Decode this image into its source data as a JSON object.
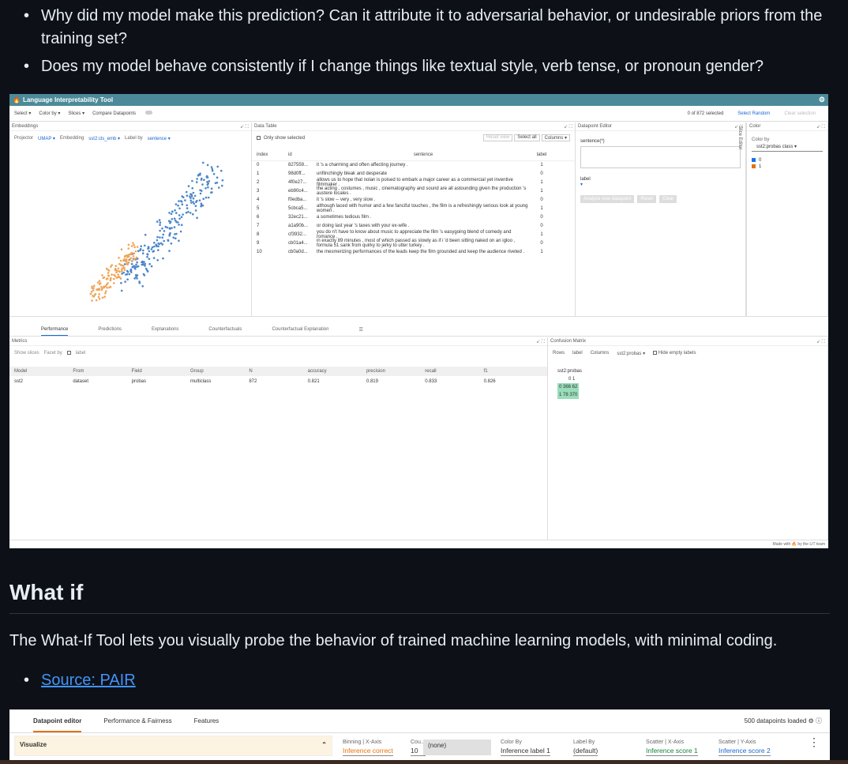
{
  "bullets": [
    "Why did my model make this prediction? Can it attribute it to adversarial behavior, or undesirable priors from the training set?",
    "Does my model behave consistently if I change things like textual style, verb tense, or pronoun gender?"
  ],
  "lit": {
    "title": "Language Interpretability Tool",
    "toolbar": {
      "select": "Select ▾",
      "color_by": "Color by ▾",
      "slices": "Slices ▾",
      "compare": "Compare Datapoints",
      "selected": "0 of 872 selected",
      "select_random": "Select Random",
      "clear": "Clear selection"
    },
    "embeddings": {
      "title": "Embeddings",
      "projector": "Projector",
      "projector_val": "UMAP ▾",
      "embedding": "Embedding",
      "embedding_val": "sst2:cls_emb ▾",
      "label_by": "Label by",
      "label_val": "sentence ▾"
    },
    "data_table": {
      "title": "Data Table",
      "only_selected": "Only show selected",
      "reset": "Reset view",
      "select_all": "Select all",
      "columns": "Columns ▾",
      "headers": [
        "index",
        "id",
        "sentence",
        "label"
      ],
      "rows": [
        [
          "0",
          "827559...",
          "it 's a charming and often affecting journey .",
          "1"
        ],
        [
          "1",
          "98d0ff...",
          "unflinchingly bleak and desperate",
          "0"
        ],
        [
          "2",
          "4f0e27...",
          "allows us to hope that nolan is poised to embark a major career as a commercial yet inventive filmmaker .",
          "1"
        ],
        [
          "3",
          "eb90c4...",
          "the acting , costumes , music , cinematography and sound are all astounding given the production 's austere locales .",
          "1"
        ],
        [
          "4",
          "f0edba...",
          "it 's slow -- very , very slow .",
          "0"
        ],
        [
          "5",
          "5cbca5...",
          "although laced with humor and a few fanciful touches , the film is a refreshingly serious look at young women .",
          "1"
        ],
        [
          "6",
          "32ec21...",
          "a sometimes tedious film .",
          "0"
        ],
        [
          "7",
          "a1a90b...",
          "or doing last year 's taxes with your ex-wife .",
          "0"
        ],
        [
          "8",
          "cf3932...",
          "you do n't have to know about music to appreciate the film 's easygoing blend of comedy and romance .",
          "1"
        ],
        [
          "9",
          "cb01a4...",
          "in exactly 89 minutes , most of which passed as slowly as if i 'd been sitting naked on an igloo , formula 51 sank from quirky to jerky to utter turkey .",
          "0"
        ],
        [
          "10",
          "cb0a0d...",
          "the mesmerizing performances of the leads keep the film grounded and keep the audience riveted .",
          "1"
        ]
      ]
    },
    "datapoint_editor": {
      "title": "Datapoint Editor",
      "field": "sentence(*)",
      "label": "label",
      "analyze": "Analyze new datapoint",
      "reset": "Reset",
      "clear": "Clear"
    },
    "slice_editor": "Slice Editor",
    "color": {
      "title": "Color",
      "color_by": "Color by",
      "value": "sst2:probas class ▾",
      "legend": [
        "0",
        "1"
      ]
    },
    "tabs": [
      "Performance",
      "Predictions",
      "Explanations",
      "Counterfactuals",
      "Counterfactual Explanation"
    ],
    "metrics": {
      "title": "Metrics",
      "show_slices": "Show slices",
      "facet_by": "Facet by",
      "facet_label": "label",
      "headers": [
        "Model",
        "From",
        "Field",
        "Group",
        "N",
        "accuracy",
        "precision",
        "recall",
        "f1"
      ],
      "row": [
        "sst2",
        "dataset",
        "probas",
        "multiclass",
        "872",
        "0.821",
        "0.819",
        "0.833",
        "0.826"
      ]
    },
    "confusion": {
      "title": "Confusion Matrix",
      "rows": "Rows",
      "rows_val": "label",
      "columns": "Columns",
      "columns_val": "sst2:probas ▾",
      "hide_empty": "Hide empty labels",
      "col_label": "sst2:probas",
      "r0": "0  366  62",
      "r1": "1  78  370",
      "hdr": "0    1"
    },
    "footer": "Made with 🔥 by the LIT team"
  },
  "heading": "What if",
  "paragraph": "The What-If Tool lets you visually probe the behavior of trained machine learning models, with minimal coding.",
  "source_link": "Source: PAIR",
  "wit": {
    "tabs": [
      "Datapoint editor",
      "Performance & Fairness",
      "Features"
    ],
    "loaded": "500 datapoints loaded",
    "visualize": "Visualize",
    "binning_x_label": "Binning | X-Axis",
    "binning_x_val": "Inference correct",
    "count_label": "Cou...",
    "count_val": "10",
    "none_option": "(none)",
    "color_by_label": "Color By",
    "color_by_val": "Inference label 1",
    "label_by_label": "Label By",
    "label_by_val": "(default)",
    "scatter_x_label": "Scatter | X-Axis",
    "scatter_x_val": "Inference score 1",
    "scatter_y_label": "Scatter | Y-Axis",
    "scatter_y_val": "Inference score 2"
  }
}
